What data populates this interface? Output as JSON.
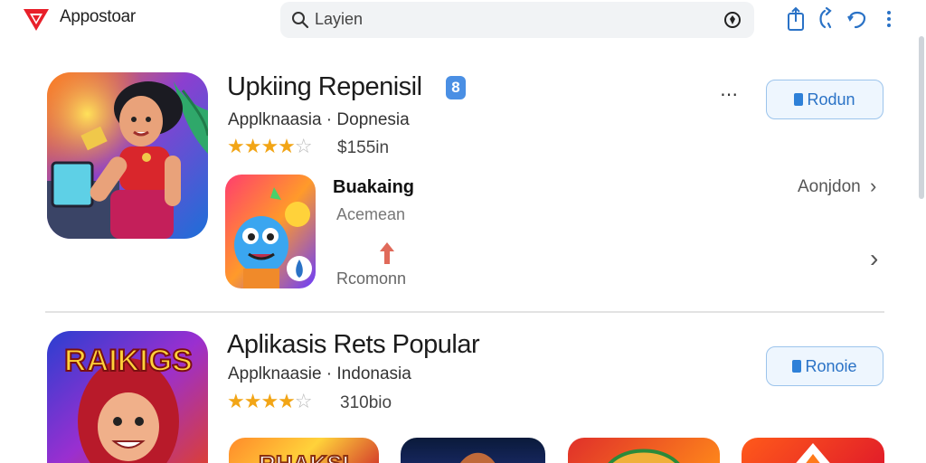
{
  "header": {
    "brand": "Appostoar",
    "search_value": "Layien"
  },
  "featured": {
    "title": "Upkiing Repenisil",
    "badge": "8",
    "subtitle": "Applknaasia · Dopnesia",
    "stars_filled": "★★★★",
    "stars_empty": "☆",
    "rating_text": "$155in",
    "rating": 4,
    "install_label": "Rodun",
    "sub_app": {
      "name": "Buakaing",
      "category": "Acemean",
      "label": "Rcomonn"
    },
    "see_all": "Aonjdon",
    "icon_caption_hidden": ""
  },
  "popular": {
    "title": "Aplikasis Rets Popular",
    "subtitle": "Applknaasie · Indonasia",
    "stars_filled": "★★★★",
    "stars_empty": "☆",
    "rating_text": "310bio",
    "rating": 4,
    "install_label": "Ronoie",
    "hero_art_text": "RAIKIGS",
    "thumb_art_text": "RHAKSI"
  },
  "colors": {
    "brand_red": "#e8202a",
    "link_blue": "#2a72c6",
    "star": "#f2a516"
  }
}
